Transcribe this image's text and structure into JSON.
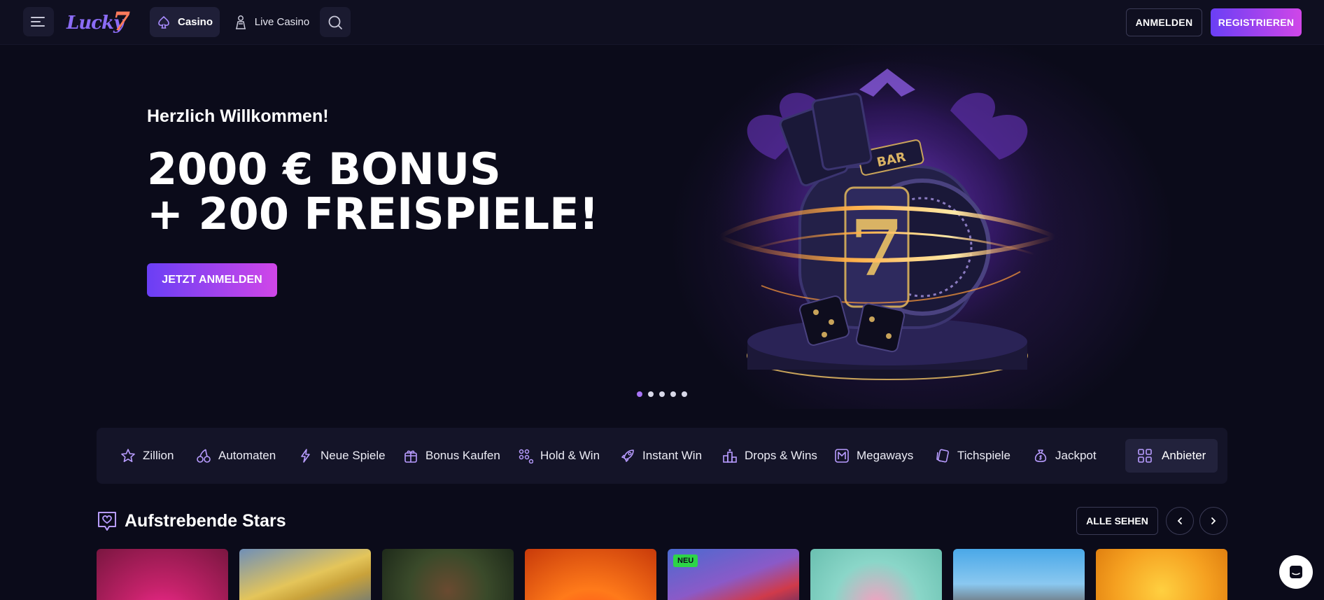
{
  "header": {
    "logo_text": "Lucky",
    "logo_number": "7",
    "nav": [
      {
        "label": "Casino",
        "icon": "spade-icon",
        "active": true
      },
      {
        "label": "Live Casino",
        "icon": "dealer-icon",
        "active": false
      }
    ],
    "login_label": "ANMELDEN",
    "register_label": "REGISTRIEREN"
  },
  "hero": {
    "welcome": "Herzlich Willkommen!",
    "title_line1": "2000 € BONUS",
    "title_line2": "+ 200 FREISPIELE!",
    "cta_label": "JETZT ANMELDEN",
    "art_text": "BAR",
    "slides": 5,
    "active_slide": 1
  },
  "categories": [
    {
      "label": "Zillion",
      "icon": "star-icon"
    },
    {
      "label": "Automaten",
      "icon": "cherries-icon"
    },
    {
      "label": "Neue Spiele",
      "icon": "lightning-icon"
    },
    {
      "label": "Bonus Kaufen",
      "icon": "gift-icon"
    },
    {
      "label": "Hold & Win",
      "icon": "dots-grid-icon"
    },
    {
      "label": "Instant Win",
      "icon": "rocket-icon"
    },
    {
      "label": "Drops & Wins",
      "icon": "podium-icon"
    },
    {
      "label": "Megaways",
      "icon": "megaways-icon"
    },
    {
      "label": "Tichspiele",
      "icon": "cards-icon"
    },
    {
      "label": "Jackpot",
      "icon": "money-bag-icon"
    }
  ],
  "providers_label": "Anbieter",
  "section": {
    "title": "Aufstrebende Stars",
    "see_all_label": "ALLE SEHEN"
  },
  "games": [
    {
      "badge": ""
    },
    {
      "badge": ""
    },
    {
      "badge": ""
    },
    {
      "badge": ""
    },
    {
      "badge": "NEU"
    },
    {
      "badge": ""
    },
    {
      "badge": ""
    },
    {
      "badge": ""
    }
  ],
  "colors": {
    "background": "#0b0b1a",
    "header": "#0f0f20",
    "accent_start": "#6a3ff5",
    "accent_end": "#d046e8",
    "category_bar": "#141428",
    "new_badge": "#2dd548"
  }
}
